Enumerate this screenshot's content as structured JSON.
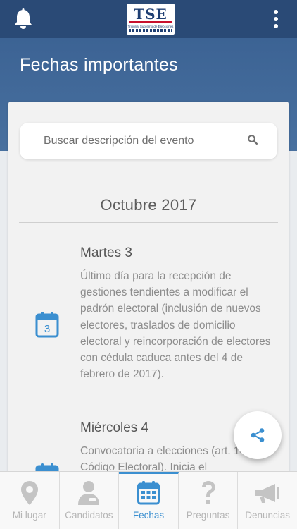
{
  "header": {
    "title": "Fechas importantes",
    "logo_mark": "TSE",
    "logo_text": "Tribunal Supremo de Elecciones"
  },
  "search": {
    "placeholder": "Buscar descripción del evento",
    "value": ""
  },
  "month": "Octubre 2017",
  "events": [
    {
      "date_label": "Martes 3",
      "day": "3",
      "description": "Último día para la recepción de gestiones tendientes a modificar el padrón electoral (inclusión de nuevos electores, traslados de domicilio electoral y reincorporación de electores con cédula caduca antes del 4 de febrero de 2017)."
    },
    {
      "date_label": "Miércoles 4",
      "day": "4",
      "description": "Convocatoria a elecciones (art. 147 del Código Electoral). Inicia el"
    }
  ],
  "nav": [
    {
      "label": "Mi lugar",
      "icon": "location-pin-icon",
      "active": false
    },
    {
      "label": "Candidatos",
      "icon": "candidate-icon",
      "active": false
    },
    {
      "label": "Fechas",
      "icon": "calendar-icon",
      "active": true
    },
    {
      "label": "Preguntas",
      "icon": "question-icon",
      "active": false
    },
    {
      "label": "Denuncias",
      "icon": "megaphone-icon",
      "active": false
    }
  ],
  "colors": {
    "topbar": "#2a4a76",
    "header": "#3c6394",
    "accent": "#3b8fd0",
    "inactive": "#b5b5b5"
  }
}
